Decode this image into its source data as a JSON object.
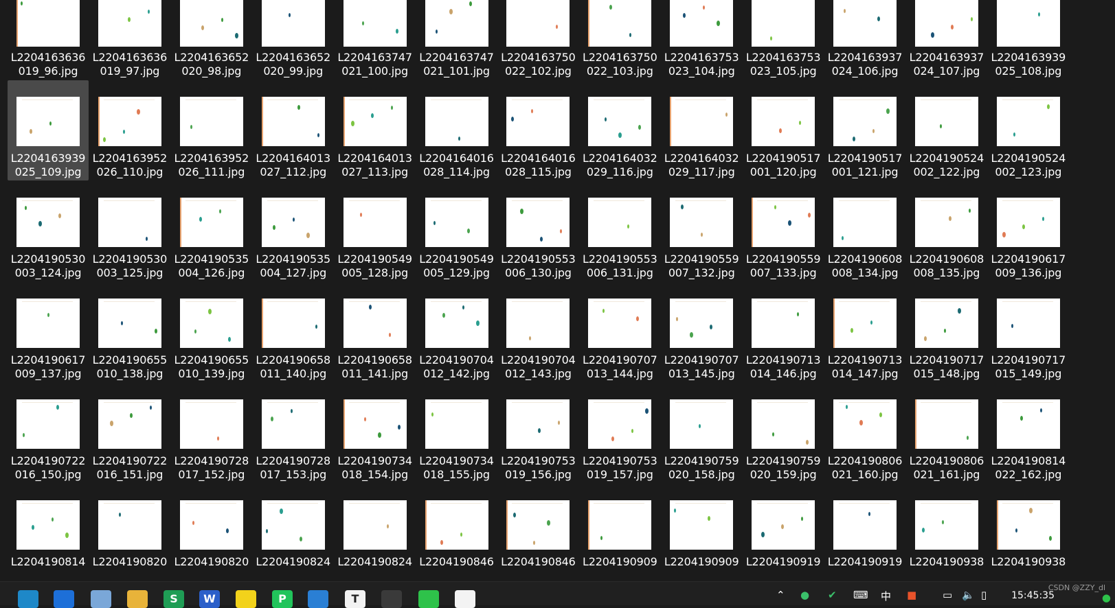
{
  "files": [
    {
      "l1": "L2204163636",
      "l2": "019_96.jpg"
    },
    {
      "l1": "L2204163636",
      "l2": "019_97.jpg"
    },
    {
      "l1": "L2204163652",
      "l2": "020_98.jpg"
    },
    {
      "l1": "L2204163652",
      "l2": "020_99.jpg"
    },
    {
      "l1": "L2204163747",
      "l2": "021_100.jpg"
    },
    {
      "l1": "L2204163747",
      "l2": "021_101.jpg"
    },
    {
      "l1": "L2204163750",
      "l2": "022_102.jpg"
    },
    {
      "l1": "L2204163750",
      "l2": "022_103.jpg"
    },
    {
      "l1": "L2204163753",
      "l2": "023_104.jpg"
    },
    {
      "l1": "L2204163753",
      "l2": "023_105.jpg"
    },
    {
      "l1": "L2204163937",
      "l2": "024_106.jpg"
    },
    {
      "l1": "L2204163937",
      "l2": "024_107.jpg"
    },
    {
      "l1": "L2204163939",
      "l2": "025_108.jpg"
    },
    {
      "l1": "L2204163939",
      "l2": "025_109.jpg"
    },
    {
      "l1": "L2204163952",
      "l2": "026_110.jpg"
    },
    {
      "l1": "L2204163952",
      "l2": "026_111.jpg"
    },
    {
      "l1": "L2204164013",
      "l2": "027_112.jpg"
    },
    {
      "l1": "L2204164013",
      "l2": "027_113.jpg"
    },
    {
      "l1": "L2204164016",
      "l2": "028_114.jpg"
    },
    {
      "l1": "L2204164016",
      "l2": "028_115.jpg"
    },
    {
      "l1": "L2204164032",
      "l2": "029_116.jpg"
    },
    {
      "l1": "L2204164032",
      "l2": "029_117.jpg"
    },
    {
      "l1": "L2204190517",
      "l2": "001_120.jpg"
    },
    {
      "l1": "L2204190517",
      "l2": "001_121.jpg"
    },
    {
      "l1": "L2204190524",
      "l2": "002_122.jpg"
    },
    {
      "l1": "L2204190524",
      "l2": "002_123.jpg"
    },
    {
      "l1": "L2204190530",
      "l2": "003_124.jpg"
    },
    {
      "l1": "L2204190530",
      "l2": "003_125.jpg"
    },
    {
      "l1": "L2204190535",
      "l2": "004_126.jpg"
    },
    {
      "l1": "L2204190535",
      "l2": "004_127.jpg"
    },
    {
      "l1": "L2204190549",
      "l2": "005_128.jpg"
    },
    {
      "l1": "L2204190549",
      "l2": "005_129.jpg"
    },
    {
      "l1": "L2204190553",
      "l2": "006_130.jpg"
    },
    {
      "l1": "L2204190553",
      "l2": "006_131.jpg"
    },
    {
      "l1": "L2204190559",
      "l2": "007_132.jpg"
    },
    {
      "l1": "L2204190559",
      "l2": "007_133.jpg"
    },
    {
      "l1": "L2204190608",
      "l2": "008_134.jpg"
    },
    {
      "l1": "L2204190608",
      "l2": "008_135.jpg"
    },
    {
      "l1": "L2204190617",
      "l2": "009_136.jpg"
    },
    {
      "l1": "L2204190617",
      "l2": "009_137.jpg"
    },
    {
      "l1": "L2204190655",
      "l2": "010_138.jpg"
    },
    {
      "l1": "L2204190655",
      "l2": "010_139.jpg"
    },
    {
      "l1": "L2204190658",
      "l2": "011_140.jpg"
    },
    {
      "l1": "L2204190658",
      "l2": "011_141.jpg"
    },
    {
      "l1": "L2204190704",
      "l2": "012_142.jpg"
    },
    {
      "l1": "L2204190704",
      "l2": "012_143.jpg"
    },
    {
      "l1": "L2204190707",
      "l2": "013_144.jpg"
    },
    {
      "l1": "L2204190707",
      "l2": "013_145.jpg"
    },
    {
      "l1": "L2204190713",
      "l2": "014_146.jpg"
    },
    {
      "l1": "L2204190713",
      "l2": "014_147.jpg"
    },
    {
      "l1": "L2204190717",
      "l2": "015_148.jpg"
    },
    {
      "l1": "L2204190717",
      "l2": "015_149.jpg"
    },
    {
      "l1": "L2204190722",
      "l2": "016_150.jpg"
    },
    {
      "l1": "L2204190722",
      "l2": "016_151.jpg"
    },
    {
      "l1": "L2204190728",
      "l2": "017_152.jpg"
    },
    {
      "l1": "L2204190728",
      "l2": "017_153.jpg"
    },
    {
      "l1": "L2204190734",
      "l2": "018_154.jpg"
    },
    {
      "l1": "L2204190734",
      "l2": "018_155.jpg"
    },
    {
      "l1": "L2204190753",
      "l2": "019_156.jpg"
    },
    {
      "l1": "L2204190753",
      "l2": "019_157.jpg"
    },
    {
      "l1": "L2204190759",
      "l2": "020_158.jpg"
    },
    {
      "l1": "L2204190759",
      "l2": "020_159.jpg"
    },
    {
      "l1": "L2204190806",
      "l2": "021_160.jpg"
    },
    {
      "l1": "L2204190806",
      "l2": "021_161.jpg"
    },
    {
      "l1": "L2204190814",
      "l2": "022_162.jpg"
    },
    {
      "l1": "L2204190814",
      "l2": ""
    },
    {
      "l1": "L2204190820",
      "l2": ""
    },
    {
      "l1": "L2204190820",
      "l2": ""
    },
    {
      "l1": "L2204190824",
      "l2": ""
    },
    {
      "l1": "L2204190824",
      "l2": ""
    },
    {
      "l1": "L2204190846",
      "l2": ""
    },
    {
      "l1": "L2204190846",
      "l2": ""
    },
    {
      "l1": "L2204190909",
      "l2": ""
    },
    {
      "l1": "L2204190909",
      "l2": ""
    },
    {
      "l1": "L2204190919",
      "l2": ""
    },
    {
      "l1": "L2204190919",
      "l2": ""
    },
    {
      "l1": "L2204190938",
      "l2": ""
    },
    {
      "l1": "L2204190938",
      "l2": ""
    }
  ],
  "selected_index": 13,
  "taskbar": {
    "apps": [
      {
        "name": "edge-icon",
        "glyph": "",
        "color": "#1e88c8"
      },
      {
        "name": "docker-icon",
        "glyph": "",
        "color": "#1d6fd8"
      },
      {
        "name": "finder-icon",
        "glyph": "",
        "color": "#7aa7d8"
      },
      {
        "name": "folder-icon",
        "glyph": "",
        "color": "#e8b33a"
      },
      {
        "name": "spreadsheet-icon",
        "glyph": "S",
        "color": "#1f9d55"
      },
      {
        "name": "word-icon",
        "glyph": "W",
        "color": "#2b5fc9"
      },
      {
        "name": "notes-icon",
        "glyph": "",
        "color": "#f2d21b"
      },
      {
        "name": "pycharm-icon",
        "glyph": "P",
        "color": "#21c45b"
      },
      {
        "name": "vscode-icon",
        "glyph": "",
        "color": "#2a7fd4"
      },
      {
        "name": "typora-icon",
        "glyph": "T",
        "color": "#f2f2f2"
      },
      {
        "name": "terminal-icon",
        "glyph": "",
        "color": "#3a3a3a"
      },
      {
        "name": "wechat-icon",
        "glyph": "",
        "color": "#2ec24a"
      },
      {
        "name": "app-icon",
        "glyph": "",
        "color": "#f3f3f3"
      }
    ],
    "tray": {
      "ime": "中",
      "clock": "15:45:35",
      "watermark": "CSDN @ZZY_dl"
    }
  }
}
